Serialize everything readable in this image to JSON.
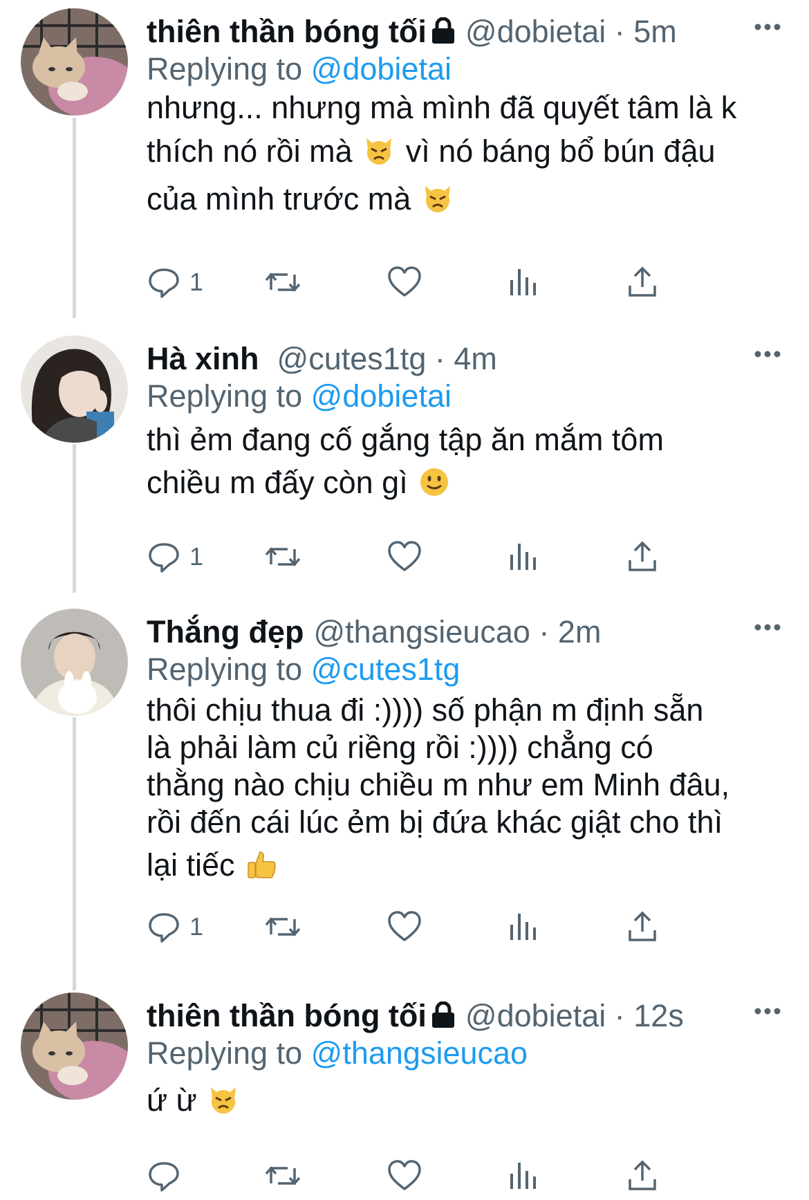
{
  "tweets": [
    {
      "name": "thiên thần bóng tối",
      "locked": true,
      "handle": "@dobietai",
      "time": "5m",
      "replying_label": "Replying to",
      "replying_to": "@dobietai",
      "lines": [
        "nhưng... nhưng mà mình đã quyết tâm là k",
        "thích nó rồi mà",
        "vì nó báng bổ bún đậu",
        "của mình trước mà"
      ],
      "reply_count": "1",
      "avatar": "kitten-in-pink-blanket"
    },
    {
      "name": "Hà xinh",
      "locked": false,
      "handle": "@cutes1tg",
      "time": "4m",
      "replying_label": "Replying to",
      "replying_to": "@dobietai",
      "lines": [
        "thì ẻm đang cố gắng tập ăn mắm tôm",
        "chiều m đấy còn gì"
      ],
      "reply_count": "1",
      "avatar": "person-long-hair"
    },
    {
      "name": "Thắng đẹp",
      "locked": false,
      "handle": "@thangsieucao",
      "time": "2m",
      "replying_label": "Replying to",
      "replying_to": "@cutes1tg",
      "lines": [
        "thôi chịu thua đi :)))) số phận m định sẵn",
        "là phải làm củ riềng rồi :)))) chẳng có",
        "thằng nào chịu chiều m như em Minh đâu,",
        "rồi đến cái lúc ẻm bị đứa khác giật cho thì",
        "lại tiếc"
      ],
      "reply_count": "1",
      "avatar": "person-holding-plush"
    },
    {
      "name": "thiên thần bóng tối",
      "locked": true,
      "handle": "@dobietai",
      "time": "12s",
      "replying_label": "Replying to",
      "replying_to": "@thangsieucao",
      "lines": [
        "ứ ừ"
      ],
      "reply_count": "",
      "avatar": "kitten-in-pink-blanket"
    }
  ],
  "separator": "·",
  "colors": {
    "link": "#1d9bf0",
    "muted": "#536471",
    "thread": "#cfd9de",
    "emoji": "#f6c342"
  },
  "icons": [
    "reply-icon",
    "retweet-icon",
    "like-icon",
    "views-icon",
    "share-icon",
    "more-icon",
    "lock-icon"
  ]
}
